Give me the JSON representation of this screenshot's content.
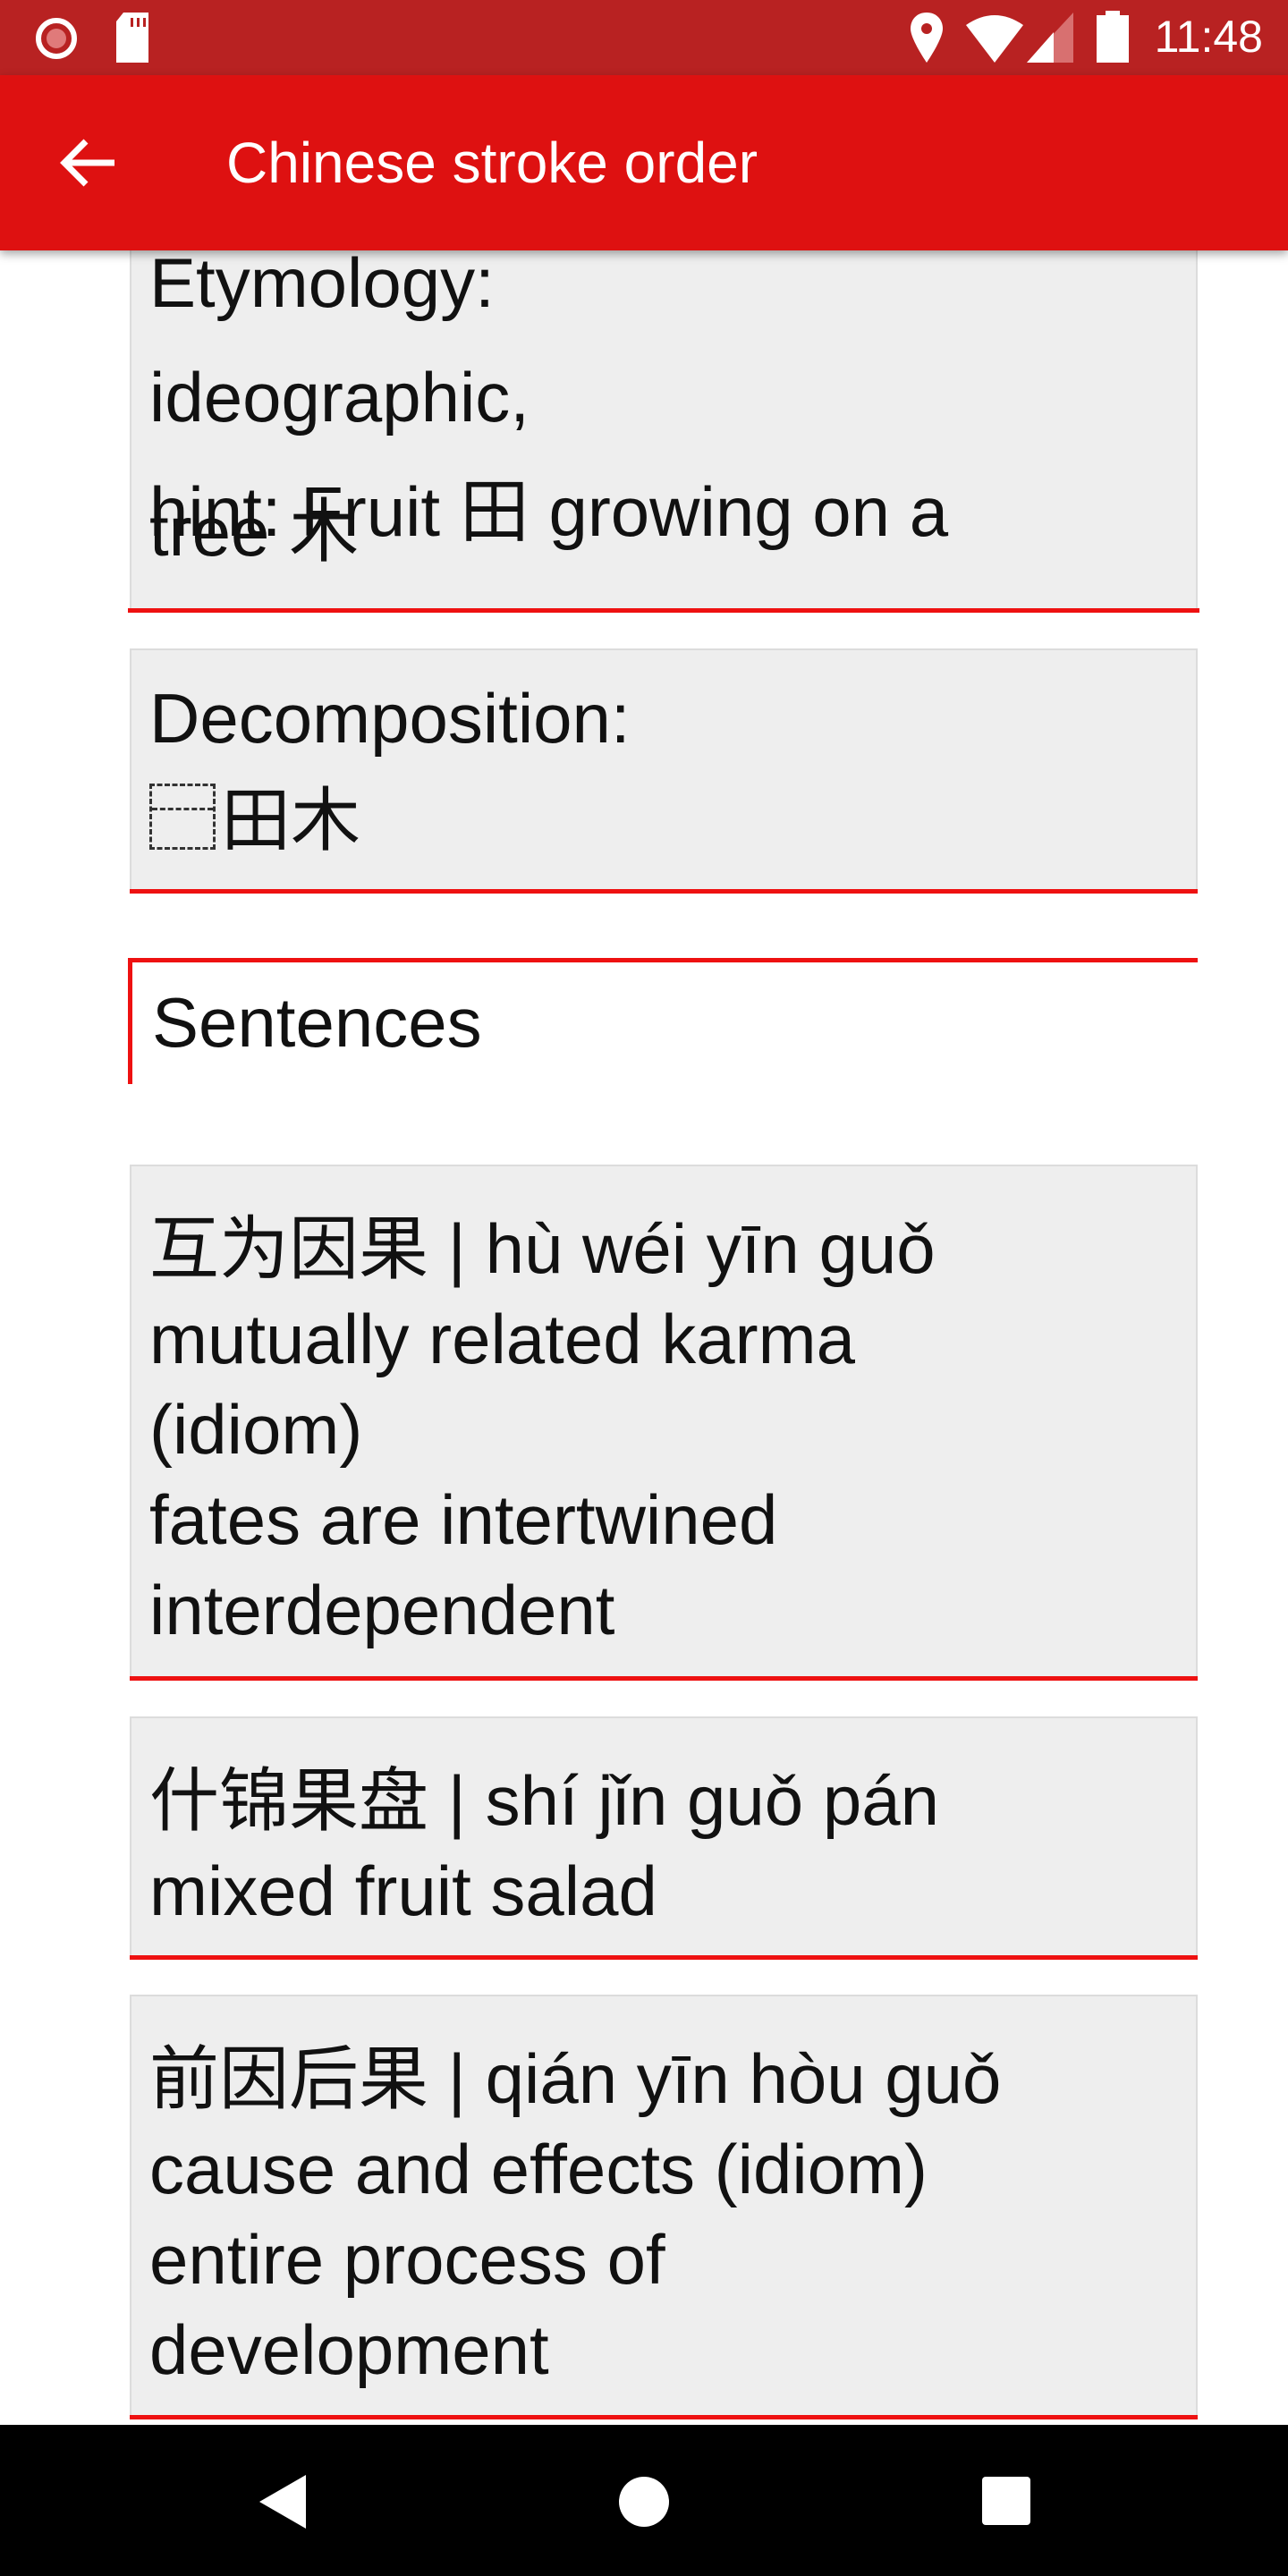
{
  "status_bar": {
    "time": "11:48",
    "icons": [
      "record-icon",
      "sd-card-icon",
      "location-icon",
      "wifi-icon",
      "signal-icon",
      "battery-icon"
    ]
  },
  "app_bar": {
    "title": "Chinese stroke order",
    "back_icon": "arrow-left-icon"
  },
  "etymology_card": {
    "line_partial": "Etymology:",
    "lines": [
      "ideographic,",
      "hint: Fruit 田 growing on a",
      "tree 木"
    ]
  },
  "decomposition_card": {
    "label": "Decomposition:",
    "value": "田木",
    "placeholder_glyph": "dashed-box-icon"
  },
  "sentences_header": "Sentences",
  "sentences": [
    {
      "text": "互为因果 | hù wéi yīn guǒ\nmutually related karma\n(idiom)\nfates are intertwined\ninterdependent"
    },
    {
      "text": "什锦果盘 | shí jǐn guǒ pán\nmixed fruit salad"
    },
    {
      "text": "前因后果 | qián yīn hòu guǒ\ncause and effects (idiom)\nentire process of\ndevelopment"
    }
  ],
  "colors": {
    "primary": "#de1111",
    "status_bar": "#b82222",
    "accent_line": "#ee1111",
    "card_bg": "#eeeeee"
  }
}
